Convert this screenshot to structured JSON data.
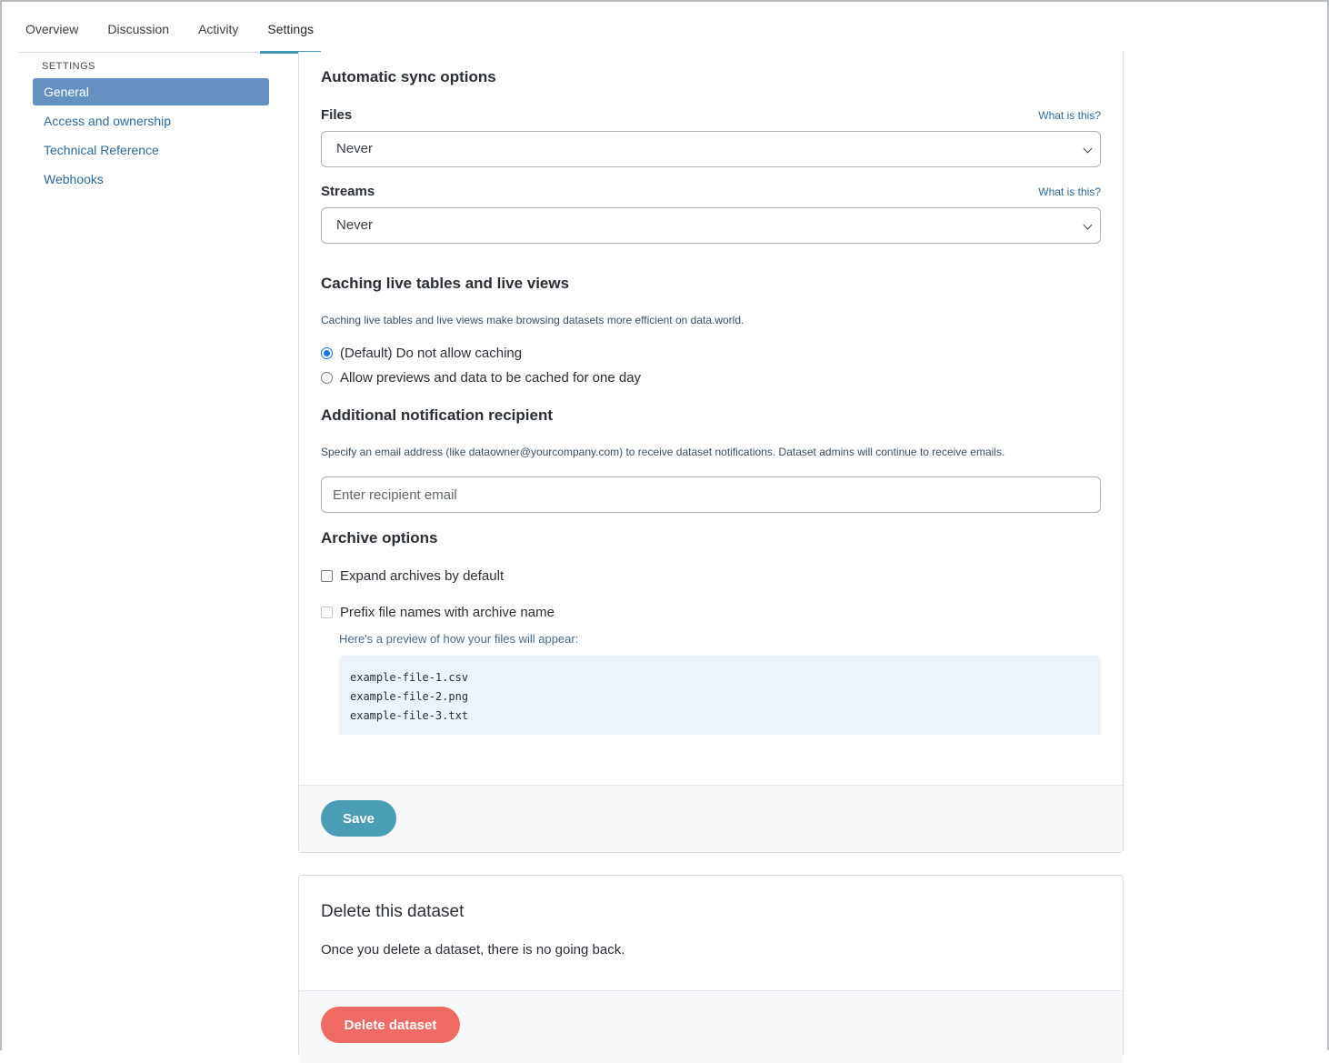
{
  "tabs": [
    {
      "label": "Overview"
    },
    {
      "label": "Discussion"
    },
    {
      "label": "Activity"
    },
    {
      "label": "Settings"
    }
  ],
  "sidebar": {
    "heading": "SETTINGS",
    "items": [
      {
        "label": "General"
      },
      {
        "label": "Access and ownership"
      },
      {
        "label": "Technical Reference"
      },
      {
        "label": "Webhooks"
      }
    ]
  },
  "sync": {
    "title": "Automatic sync options",
    "files_label": "Files",
    "files_help": "What is this?",
    "files_value": "Never",
    "streams_label": "Streams",
    "streams_help": "What is this?",
    "streams_value": "Never"
  },
  "caching": {
    "title": "Caching live tables and live views",
    "description": "Caching live tables and live views make browsing datasets more efficient on data.world.",
    "option_default": "(Default) Do not allow caching",
    "option_allow": "Allow previews and data to be cached for one day",
    "selected": "default"
  },
  "notification": {
    "title": "Additional notification recipient",
    "description": "Specify an email address (like dataowner@yourcompany.com) to receive dataset notifications. Dataset admins will continue to receive emails.",
    "placeholder": "Enter recipient email",
    "value": ""
  },
  "archive": {
    "title": "Archive options",
    "expand_label": "Expand archives by default",
    "prefix_label": "Prefix file names with archive name",
    "preview_text": "Here's a preview of how your files will appear:",
    "preview_files": [
      "example-file-1.csv",
      "example-file-2.png",
      "example-file-3.txt"
    ]
  },
  "save_label": "Save",
  "delete": {
    "title": "Delete this dataset",
    "description": "Once you delete a dataset, there is no going back.",
    "button_label": "Delete dataset"
  },
  "colors": {
    "tab_active_underline": "#3e9cb1",
    "sidebar_active": "#6491c2",
    "link": "#2f6a9b",
    "save_button": "#4a9db7",
    "delete_button": "#ee6a63"
  },
  "icons": {
    "select_chevron": "chevron-down-icon",
    "radio": "radio-icon",
    "checkbox": "checkbox-icon"
  }
}
